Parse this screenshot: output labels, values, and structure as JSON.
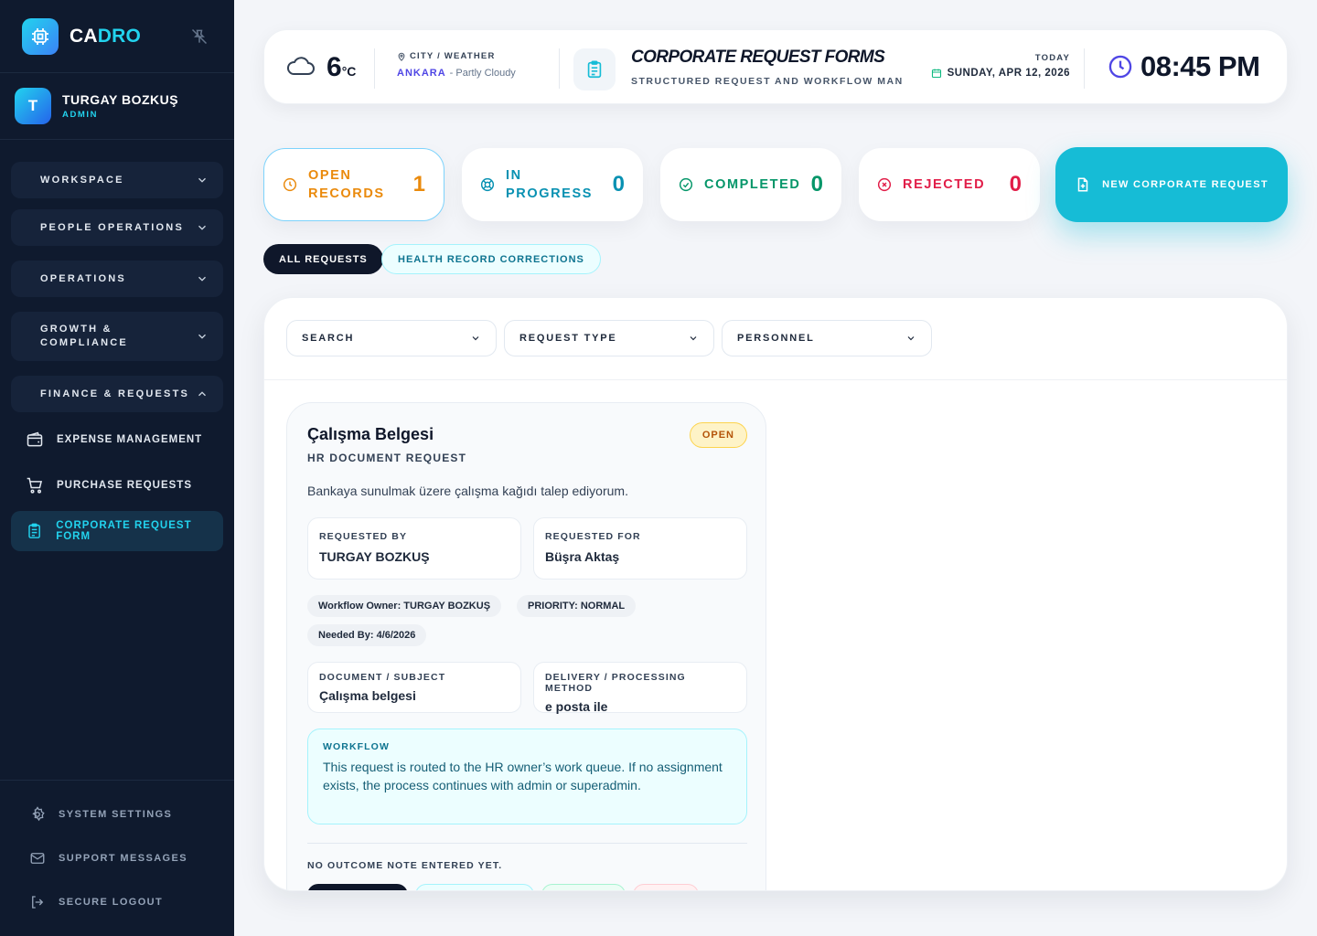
{
  "brand": {
    "name_part1": "CA",
    "name_part2": "DRO"
  },
  "user": {
    "initial": "T",
    "name": "TURGAY BOZKUŞ",
    "role": "ADMIN"
  },
  "sidebar": {
    "groups": [
      {
        "label": "WORKSPACE"
      },
      {
        "label": "PEOPLE OPERATIONS"
      },
      {
        "label": "OPERATIONS"
      },
      {
        "label": "GROWTH & COMPLIANCE"
      },
      {
        "label": "FINANCE & REQUESTS"
      }
    ],
    "items": [
      {
        "label": "EXPENSE MANAGEMENT"
      },
      {
        "label": "PURCHASE REQUESTS"
      },
      {
        "label": "CORPORATE REQUEST FORM",
        "active": true
      }
    ],
    "footer": [
      {
        "label": "SYSTEM SETTINGS"
      },
      {
        "label": "SUPPORT MESSAGES"
      },
      {
        "label": "SECURE LOGOUT"
      }
    ]
  },
  "header": {
    "temp": "6",
    "temp_unit": "°C",
    "city_label": "CITY / WEATHER",
    "city": "ANKARA",
    "condition": "- Partly Cloudy",
    "title": "CORPORATE REQUEST FORMS",
    "subtitle": "STRUCTURED REQUEST AND WORKFLOW MAN",
    "today_label": "TODAY",
    "date": "SUNDAY, APR 12, 2026",
    "time": "08:45 PM"
  },
  "stats": {
    "open": {
      "label_line1": "OPEN",
      "label_line2": "RECORDS",
      "value": "1"
    },
    "progress": {
      "label_line1": "IN",
      "label_line2": "PROGRESS",
      "value": "0"
    },
    "completed": {
      "label": "COMPLETED",
      "value": "0"
    },
    "rejected": {
      "label": "REJECTED",
      "value": "0"
    }
  },
  "new_request_label": "NEW CORPORATE REQUEST",
  "tabs": {
    "all": "ALL REQUESTS",
    "health": "HEALTH RECORD CORRECTIONS"
  },
  "filters": {
    "search": "SEARCH",
    "type": "REQUEST TYPE",
    "personnel": "PERSONNEL"
  },
  "card": {
    "title": "Çalışma Belgesi",
    "type": "HR DOCUMENT REQUEST",
    "status": "OPEN",
    "description": "Bankaya sunulmak üzere çalışma kağıdı talep ediyorum.",
    "requested_by_label": "REQUESTED BY",
    "requested_by": "TURGAY BOZKUŞ",
    "requested_for_label": "REQUESTED FOR",
    "requested_for": "Büşra Aktaş",
    "chips": {
      "owner": "Workflow Owner: TURGAY BOZKUŞ",
      "priority": "PRIORITY: NORMAL",
      "needed_by": "Needed By: 4/6/2026"
    },
    "document_label": "DOCUMENT / SUBJECT",
    "document": "Çalışma belgesi",
    "delivery_label": "DELIVERY / PROCESSING METHOD",
    "delivery": "e posta ile",
    "workflow_label": "WORKFLOW",
    "workflow_text": "This request is routed to the HR owner’s work queue. If no assignment exists, the process continues with admin or superadmin.",
    "outcome": "NO OUTCOME NOTE ENTERED YET."
  }
}
